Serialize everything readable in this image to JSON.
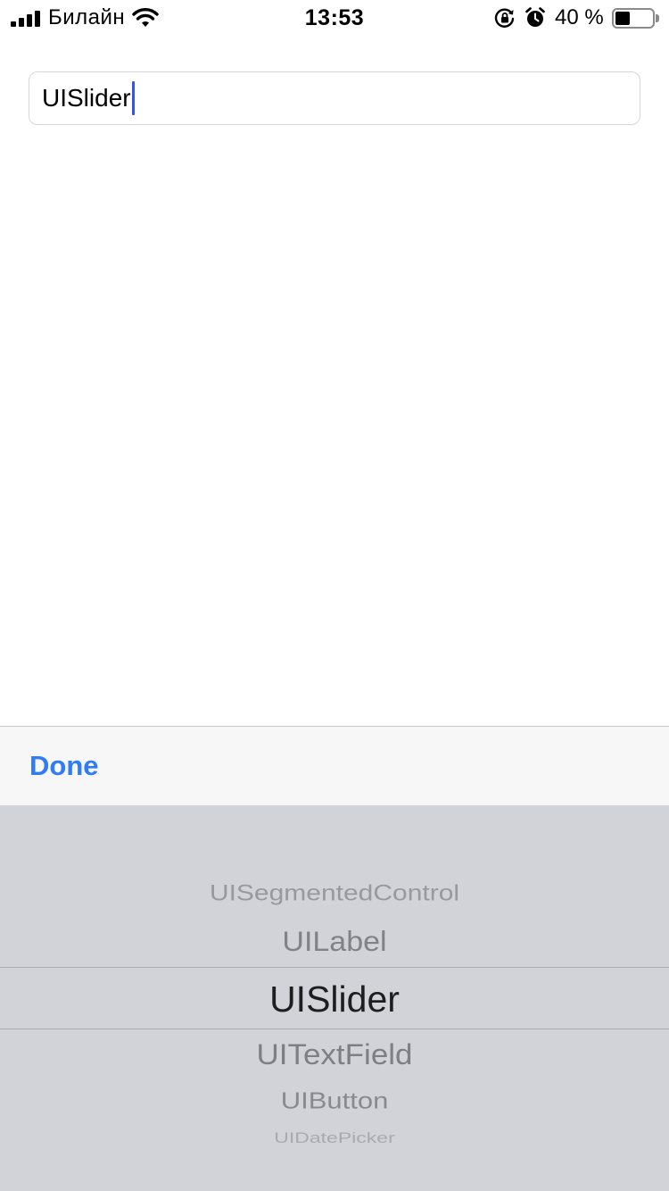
{
  "status_bar": {
    "carrier": "Билайн",
    "time": "13:53",
    "battery_percent_text": "40 %",
    "battery_level": 0.4,
    "signal_bars": 4
  },
  "text_field": {
    "value": "UISlider"
  },
  "toolbar": {
    "done_label": "Done",
    "accent_color": "#2f7cf6"
  },
  "picker": {
    "options": [
      "UISegmentedControl",
      "UILabel",
      "UISlider",
      "UITextField",
      "UIButton",
      "UIDatePicker"
    ],
    "selected": "UISlider",
    "background_color": "#d1d3d9"
  },
  "icons": {
    "signal": "cellular-signal-icon",
    "wifi": "wifi-icon",
    "rotation_lock": "rotation-lock-icon",
    "alarm": "alarm-clock-icon",
    "battery": "battery-icon"
  }
}
